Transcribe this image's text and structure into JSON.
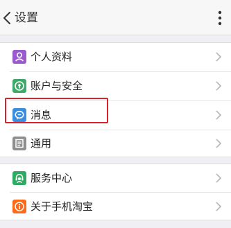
{
  "header": {
    "title": "设置",
    "back_icon": "back-chevron-icon",
    "more_icon": "more-vertical-icon"
  },
  "groups": [
    {
      "items": [
        {
          "label": "个人资料",
          "icon": "profile-icon",
          "color": "#9b59d0"
        },
        {
          "label": "账户与安全",
          "icon": "account-security-icon",
          "color": "#3fa86b"
        },
        {
          "label": "消息",
          "icon": "message-icon",
          "color": "#3a8ee0",
          "highlighted": true
        },
        {
          "label": "通用",
          "icon": "general-icon",
          "color": "#8e8e8e"
        }
      ]
    },
    {
      "items": [
        {
          "label": "服务中心",
          "icon": "service-center-icon",
          "color": "#2eaa62"
        },
        {
          "label": "关于手机淘宝",
          "icon": "about-icon",
          "color": "#ff6a1a"
        }
      ]
    }
  ],
  "colors": {
    "highlight_box": "#d6222a",
    "page_background": "#efeff4"
  }
}
